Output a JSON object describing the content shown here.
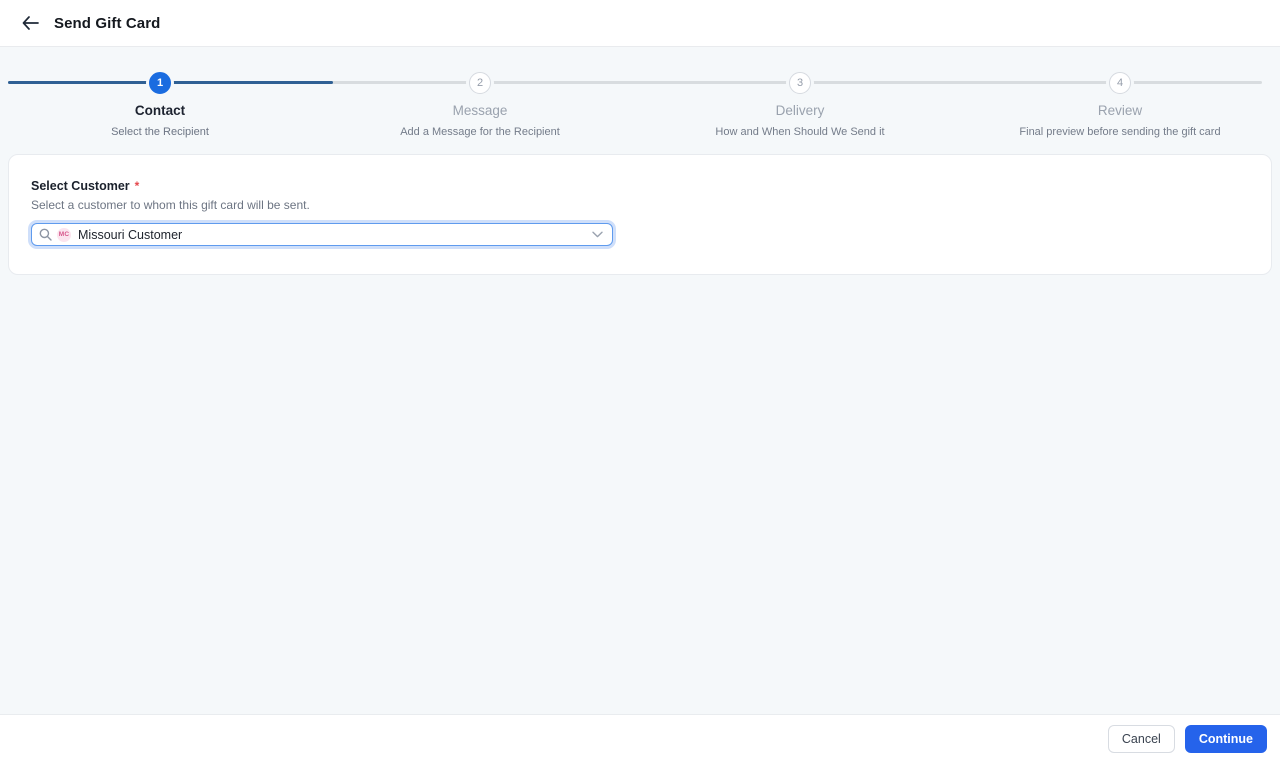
{
  "header": {
    "title": "Send Gift Card"
  },
  "stepper": {
    "steps": [
      {
        "number": "1",
        "title": "Contact",
        "subtitle": "Select the Recipient",
        "state": "active"
      },
      {
        "number": "2",
        "title": "Message",
        "subtitle": "Add a Message for the Recipient",
        "state": "upcoming"
      },
      {
        "number": "3",
        "title": "Delivery",
        "subtitle": "How and When Should We Send it",
        "state": "upcoming"
      },
      {
        "number": "4",
        "title": "Review",
        "subtitle": "Final preview before sending the gift card",
        "state": "upcoming"
      }
    ]
  },
  "form": {
    "label": "Select Customer",
    "required_marker": "*",
    "description": "Select a customer to whom this gift card will be sent.",
    "select": {
      "value": "Missouri Customer",
      "avatar_initials": "MC"
    }
  },
  "footer": {
    "cancel_label": "Cancel",
    "continue_label": "Continue"
  },
  "colors": {
    "accent_blue": "#2563eb",
    "active_step_circle": "#1a6ce0",
    "progress_line": "#2f6094",
    "inactive_line": "#d8dcdf",
    "page_background": "#f5f8fa",
    "required_red": "#e5484d",
    "avatar_pink_bg": "#fbe4ee",
    "avatar_pink_text": "#d6568a"
  }
}
